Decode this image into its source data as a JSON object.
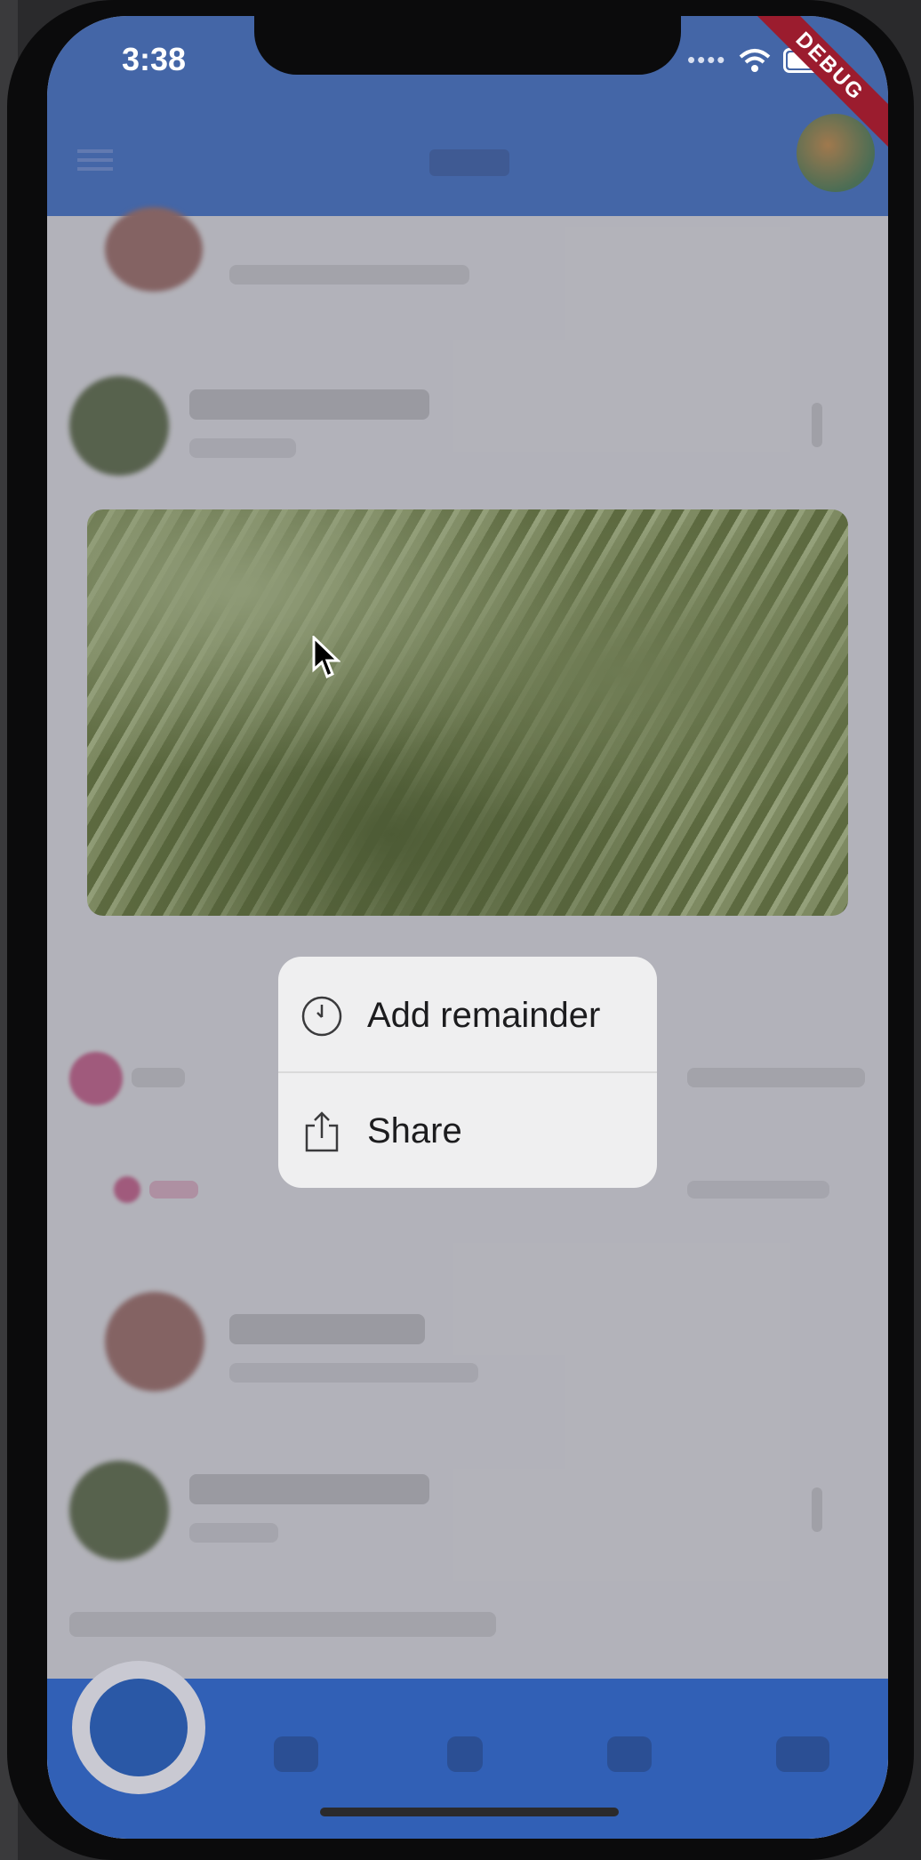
{
  "status_bar": {
    "time": "3:38",
    "signal": "••••",
    "debug_banner": "DEBUG"
  },
  "context_menu": {
    "items": [
      {
        "label": "Add remainder",
        "icon": "clock-icon"
      },
      {
        "label": "Share",
        "icon": "share-icon"
      }
    ]
  },
  "colors": {
    "primary": "#3160b6",
    "menu_bg": "#efeff0",
    "debug_banner": "#9b1c2e"
  }
}
